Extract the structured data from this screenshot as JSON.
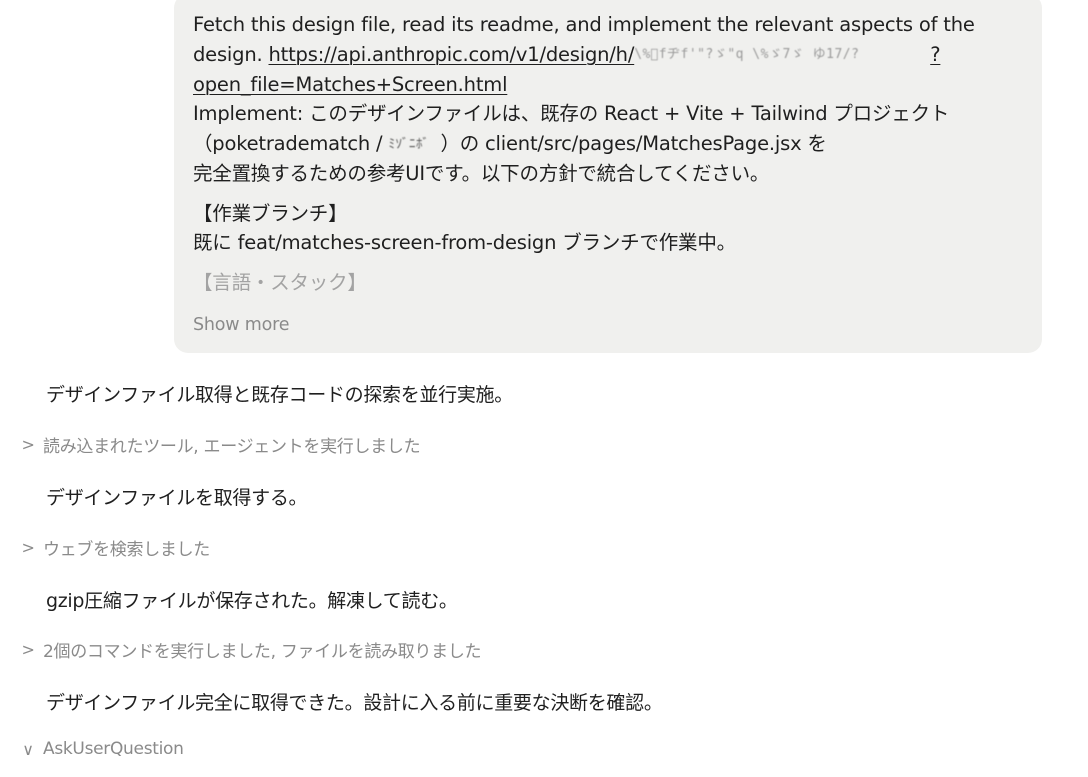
{
  "user_message": {
    "line1": "Fetch this design file, read its readme, and implement the relevant aspects of the",
    "line2_prefix": "design. ",
    "link_part1": "https://api.anthropic.com/v1/design/h/",
    "link_redacted": "\\%゙fヂf'\"?ゞ\"q \\%ゞ7ゞ ゆ17/?",
    "link_part2": "?",
    "link_part3": "open_file=Matches+Screen.html",
    "line4": "Implement: このデザインファイルは、既存の React + Vite + Tailwind プロジェクト",
    "line5_prefix": "（poketradematch / ",
    "line5_redacted": "ﾐｿﾞﾆﾎﾞ",
    "line5_suffix": "）の client/src/pages/MatchesPage.jsx を",
    "line6": "完全置換するための参考UIです。以下の方針で統合してください。",
    "section1_title": "【作業ブランチ】",
    "section1_body": "既に feat/matches-screen-from-design ブランチで作業中。",
    "section2_title": "【言語・スタック】",
    "show_more": "Show more"
  },
  "transcript": [
    {
      "type": "text",
      "text": "デザインファイル取得と既存コードの探索を並行実施。"
    },
    {
      "type": "tool",
      "chevron": ">",
      "label": "読み込まれたツール, エージェントを実行しました"
    },
    {
      "type": "text",
      "text": "デザインファイルを取得する。"
    },
    {
      "type": "tool",
      "chevron": ">",
      "label": "ウェブを検索しました"
    },
    {
      "type": "text",
      "text": "gzip圧縮ファイルが保存された。解凍して読む。"
    },
    {
      "type": "tool",
      "chevron": ">",
      "label": "2個のコマンドを実行しました, ファイルを読み取りました"
    },
    {
      "type": "text",
      "text": "デザインファイル完全に取得できた。設計に入る前に重要な決断を確認。"
    },
    {
      "type": "tool",
      "chevron": "∨",
      "label": "AskUserQuestion"
    }
  ]
}
